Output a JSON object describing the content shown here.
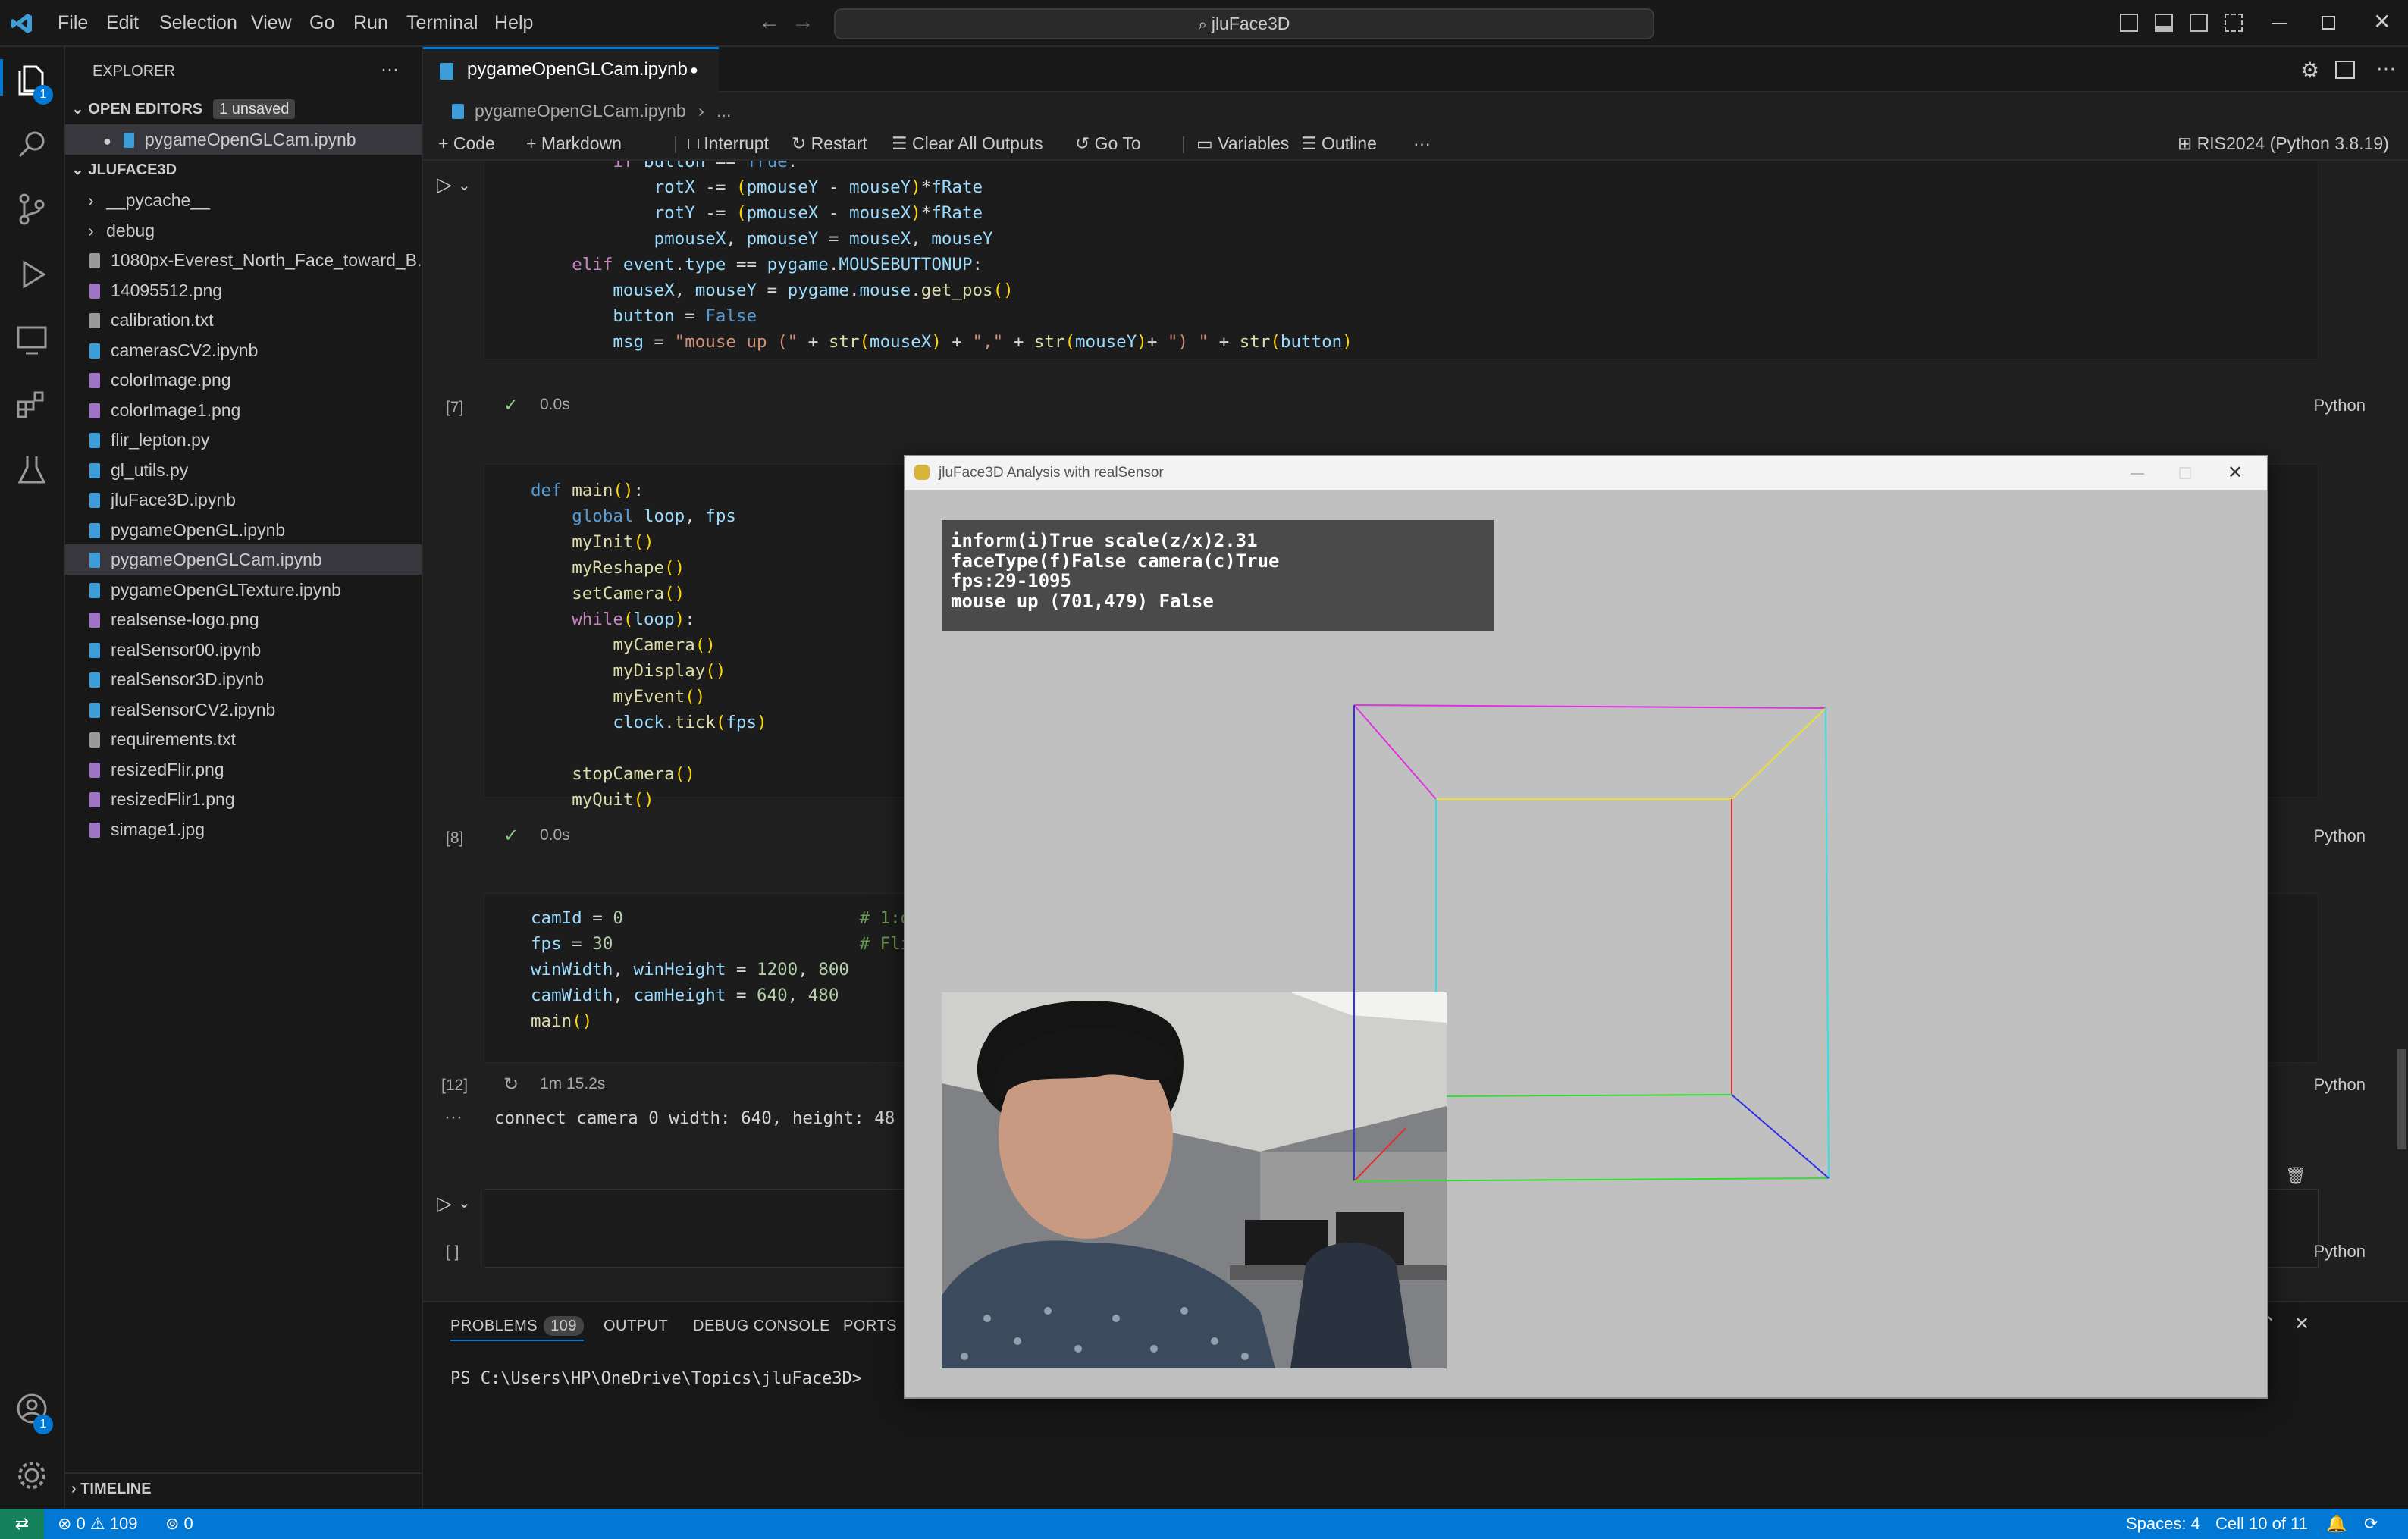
{
  "menu": [
    "File",
    "Edit",
    "Selection",
    "View",
    "Go",
    "Run",
    "Terminal",
    "Help"
  ],
  "command_center": "jluFace3D",
  "sidebar": {
    "title": "EXPLORER",
    "open_editors": "OPEN EDITORS",
    "unsaved": "1 unsaved",
    "open_file": "pygameOpenGLCam.ipynb",
    "project": "JLUFACE3D",
    "items": [
      "__pycache__",
      "debug",
      "1080px-Everest_North_Face_toward_B...",
      "14095512.png",
      "calibration.txt",
      "camerasCV2.ipynb",
      "colorImage.png",
      "colorImage1.png",
      "flir_lepton.py",
      "gl_utils.py",
      "jluFace3D.ipynb",
      "pygameOpenGL.ipynb",
      "pygameOpenGLCam.ipynb",
      "pygameOpenGLTexture.ipynb",
      "realsense-logo.png",
      "realSensor00.ipynb",
      "realSensor3D.ipynb",
      "realSensorCV2.ipynb",
      "requirements.txt",
      "resizedFlir.png",
      "resizedFlir1.png",
      "simage1.jpg"
    ],
    "timeline": "TIMELINE"
  },
  "tab": {
    "label": "pygameOpenGLCam.ipynb"
  },
  "breadcrumb": {
    "file": "pygameOpenGLCam.ipynb",
    "more": "..."
  },
  "toolbar": {
    "code": "Code",
    "markdown": "Markdown",
    "interrupt": "Interrupt",
    "restart": "Restart",
    "clear": "Clear All Outputs",
    "goto": "Go To",
    "variables": "Variables",
    "outline": "Outline",
    "kernel": "RIS2024 (Python 3.8.19)"
  },
  "cells": {
    "c7": {
      "exec": "[7]",
      "time": "0.0s",
      "lang": "Python"
    },
    "c8": {
      "exec": "[8]",
      "time": "0.0s",
      "lang": "Python"
    },
    "c12": {
      "exec": "[12]",
      "time": "1m 15.2s",
      "lang": "Python",
      "output": "connect camera 0 width: 640, height: 48"
    },
    "empty": {
      "exec": "[ ]",
      "lang": "Python"
    }
  },
  "panel": {
    "problems": "PROBLEMS",
    "problems_count": "109",
    "output": "OUTPUT",
    "debug": "DEBUG CONSOLE",
    "ports": "PORTS",
    "prompt": "PS C:\\Users\\HP\\OneDrive\\Topics\\jluFace3D>"
  },
  "statusbar": {
    "errors": "0",
    "warnings": "109",
    "ports": "0",
    "spaces": "Spaces: 4",
    "cell": "Cell 10 of 11"
  },
  "pygame": {
    "title": "jluFace3D Analysis with realSensor",
    "overlay": [
      "inform(i)True scale(z/x)2.31",
      "faceType(f)False camera(c)True",
      "fps:29-1095",
      "mouse up (701,479) False"
    ]
  },
  "colors": {
    "accent": "#0078d4",
    "status": "#0078d4",
    "bg": "#1f1f1f"
  }
}
